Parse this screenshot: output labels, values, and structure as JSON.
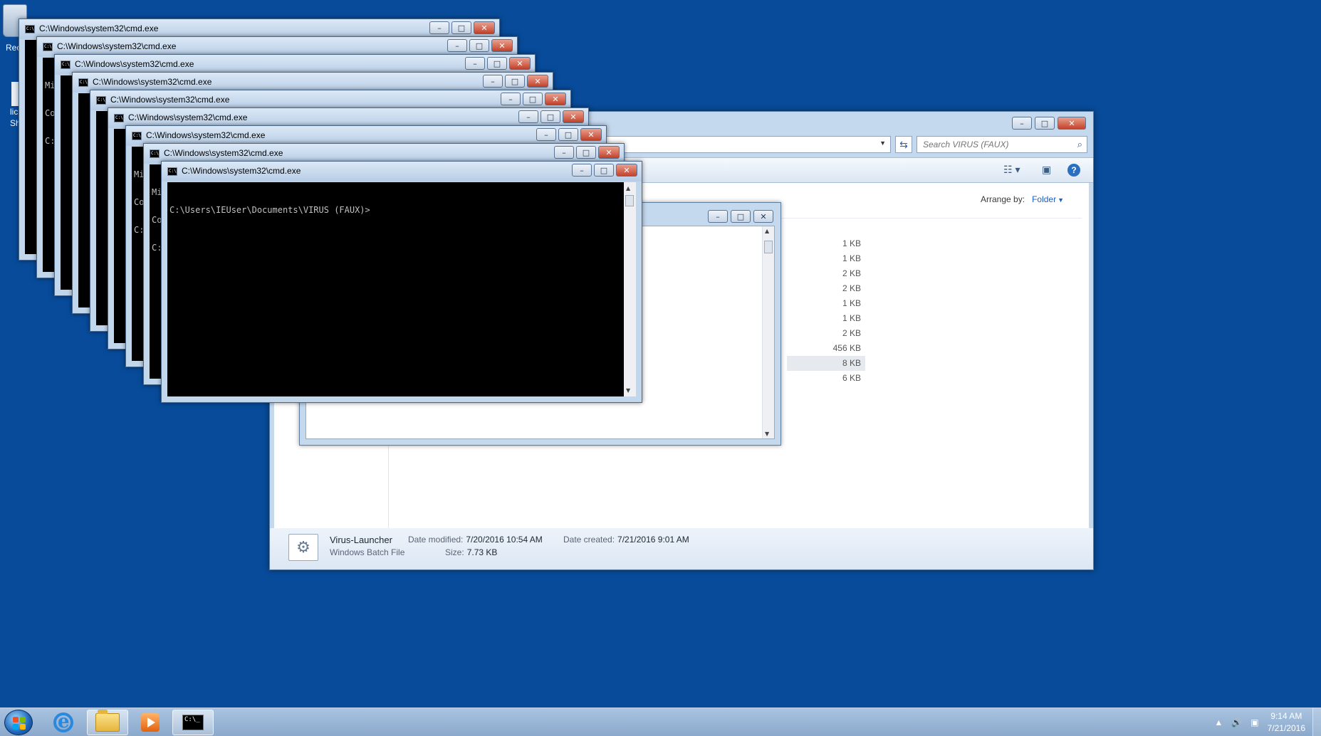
{
  "desktop": {
    "recycle_bin_label": "Rec",
    "shortcut_label_1": "lic",
    "shortcut_label_2": "Sh"
  },
  "explorer": {
    "search_placeholder": "Search VIRUS (FAUX)",
    "arrange_by_label": "Arrange by:",
    "arrange_by_value": "Folder",
    "sizes": [
      "1 KB",
      "1 KB",
      "2 KB",
      "2 KB",
      "1 KB",
      "1 KB",
      "2 KB",
      "456 KB",
      "8 KB",
      "6 KB"
    ],
    "details": {
      "file_name": "Virus-Launcher",
      "file_type": "Windows Batch File",
      "date_modified_label": "Date modified:",
      "date_modified": "7/20/2016 10:54 AM",
      "date_created_label": "Date created:",
      "date_created": "7/21/2016 9:01 AM",
      "size_label": "Size:",
      "size": "7.73 KB"
    }
  },
  "cmd_windows": {
    "title": "C:\\Windows\\system32\\cmd.exe",
    "top_prompt": "C:\\Users\\IEUser\\Documents\\VIRUS (FAUX)>",
    "partial_line_1": "Mi",
    "partial_line_2": "Co",
    "partial_line_3": "C:"
  },
  "window_controls": {
    "minimize": "–",
    "maximize": "□",
    "close": "✕"
  },
  "taskbar": {
    "time": "9:14 AM",
    "date": "7/21/2016"
  },
  "colors": {
    "desktop": "#084b9a",
    "window_frame": "#c4d8ee",
    "close_button": "#c4422b",
    "link_blue": "#1c5ec0"
  }
}
